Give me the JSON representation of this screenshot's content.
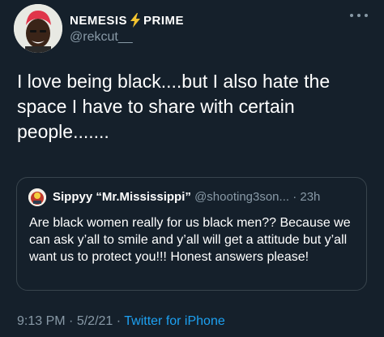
{
  "author": {
    "name_part1": "NEMESIS",
    "name_part2": "PRIME",
    "handle": "@rekcut__"
  },
  "tweet": {
    "text": "I love being black....but I also hate the space I have to share with certain people......."
  },
  "quoted": {
    "name": "Sippyy “Mr.Mississippi”",
    "handle": "@shooting3son...",
    "separator": "·",
    "time": "23h",
    "text": "Are black women really for us black men?? Because we can ask y’all to smile and y’all will get a attitude but y’all want us to protect you!!! Honest answers please!"
  },
  "meta": {
    "time": "9:13 PM",
    "sep1": "·",
    "date": "5/2/21",
    "sep2": "·",
    "source": "Twitter for iPhone"
  },
  "colors": {
    "background": "#15202b",
    "secondary_text": "#8899a6",
    "link": "#1da1f2",
    "border": "#38444d",
    "bolt": "#f4c430",
    "avatar_hair": "#e0354a"
  },
  "icons": {
    "more": "more-horizontal-icon",
    "bolt": "lightning-bolt-icon"
  }
}
